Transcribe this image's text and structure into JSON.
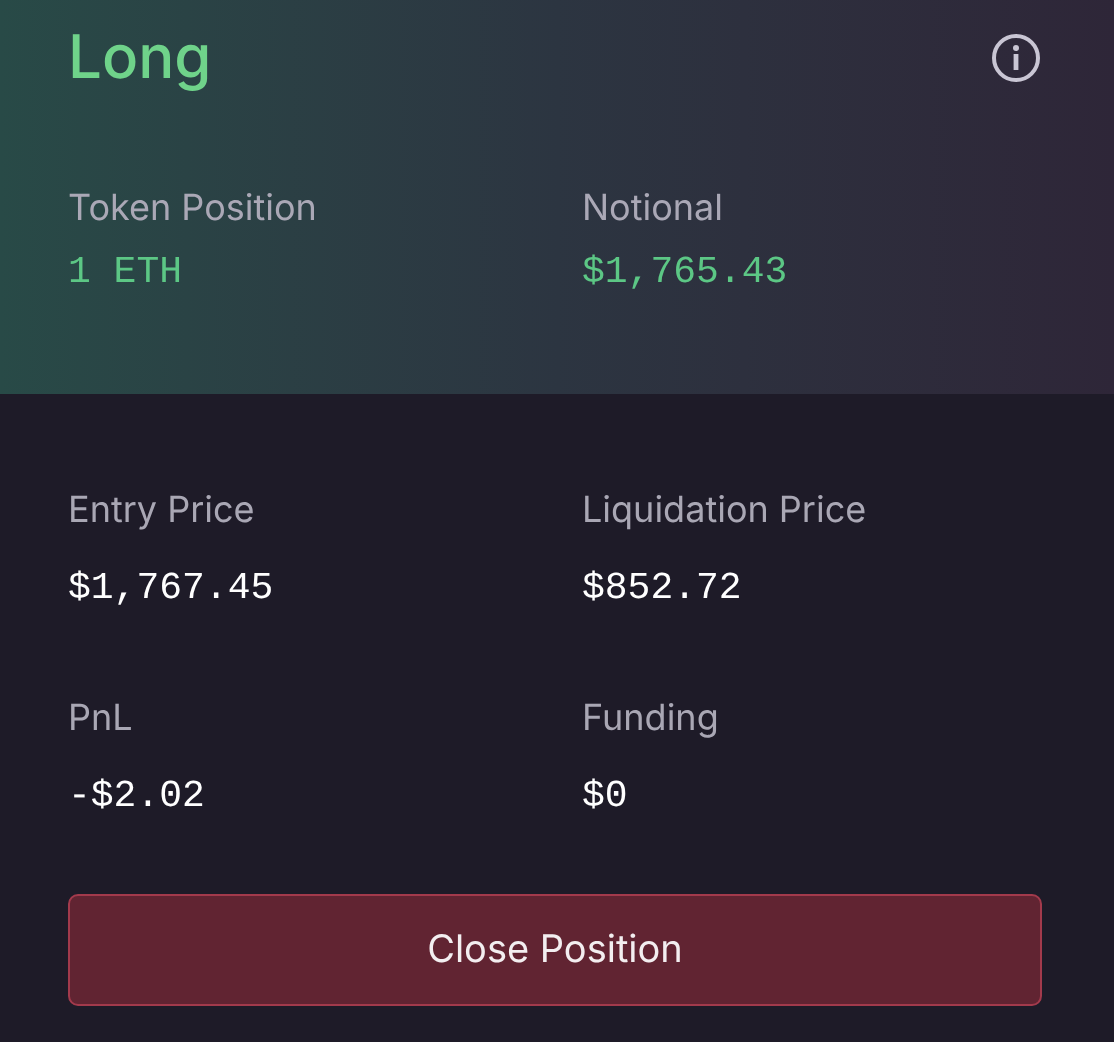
{
  "header": {
    "title": "Long",
    "stats": [
      {
        "label": "Token Position",
        "value": "1 ETH"
      },
      {
        "label": "Notional",
        "value": "$1,765.43"
      }
    ]
  },
  "details": [
    {
      "label": "Entry Price",
      "value": "$1,767.45"
    },
    {
      "label": "Liquidation Price",
      "value": "$852.72"
    },
    {
      "label": "PnL",
      "value": "-$2.02"
    },
    {
      "label": "Funding",
      "value": "$0"
    }
  ],
  "button": {
    "label": "Close Position"
  }
}
